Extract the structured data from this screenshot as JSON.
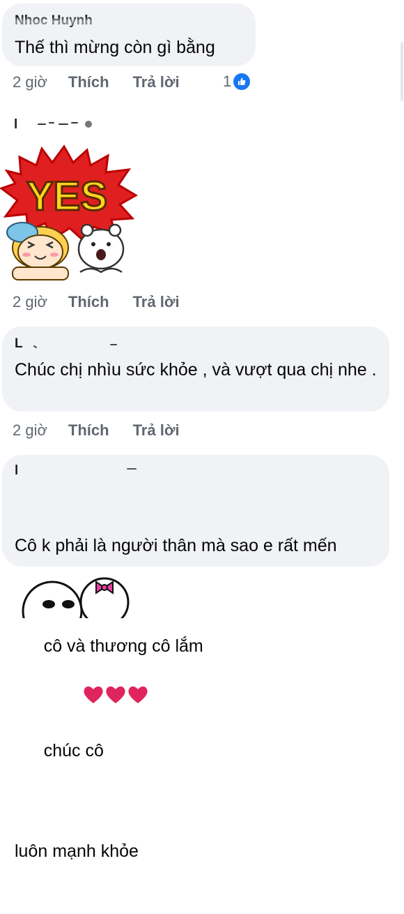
{
  "comments": [
    {
      "author": "Nhoc Huynh",
      "text": "Thế thì mừng còn gì bằng",
      "time": "2 giờ",
      "like_label": "Thích",
      "reply_label": "Trả lời",
      "reaction_count": "1"
    },
    {
      "author": "l",
      "sticker": {
        "caption": "YES"
      },
      "time": "2 giờ",
      "like_label": "Thích",
      "reply_label": "Trả lời"
    },
    {
      "author": "L",
      "text": "Chúc chị nhìu sức khỏe , và vượt qua chị nhe .",
      "time": "2 giờ",
      "like_label": "Thích",
      "reply_label": "Trả lời"
    },
    {
      "author": "l",
      "text_line1": "Cô k phải là người thân mà sao e rất mến",
      "text_line2_start": "cô và thương cô lắm",
      "text_line2_end": "chúc cô",
      "text_line3": "luôn mạnh khỏe"
    }
  ],
  "colors": {
    "bubble": "#f0f2f5",
    "meta": "#606770",
    "like_blue": "#1877f2",
    "heart_red": "#e0245e",
    "sticker_red": "#e02020",
    "sticker_yellow": "#ffd51f"
  },
  "icons": [
    "like-reaction-icon",
    "heart-emoji",
    "yes-sticker",
    "sticker-partial"
  ]
}
